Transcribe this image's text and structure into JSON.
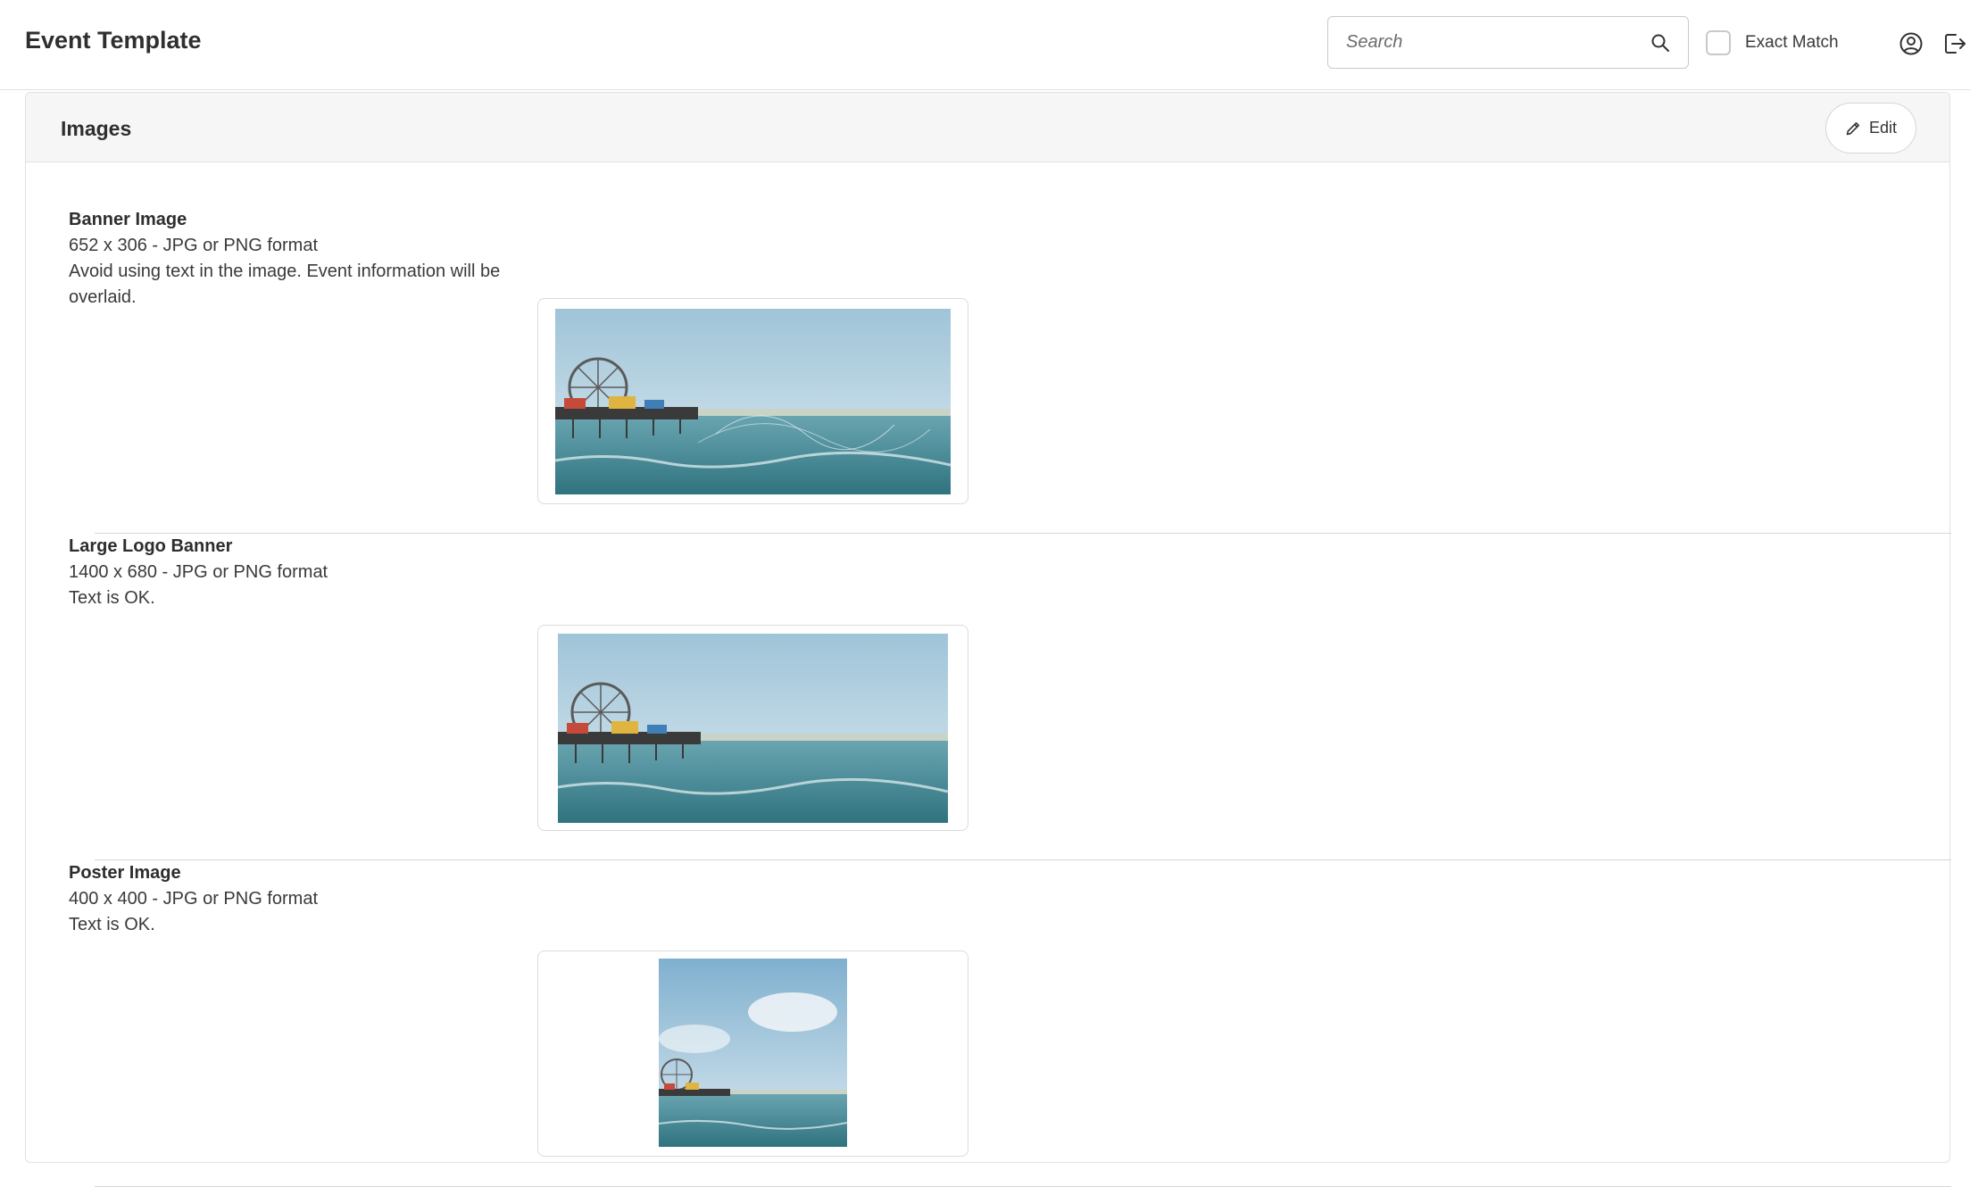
{
  "header": {
    "title": "Event Template",
    "search_placeholder": "Search",
    "search_value": "",
    "exact_match_label": "Exact Match",
    "exact_match_checked": false,
    "icons": [
      "search-icon",
      "user-icon",
      "logout-icon"
    ]
  },
  "images_section": {
    "title": "Images",
    "edit_label": "Edit",
    "rows": [
      {
        "title": "Banner Image",
        "spec": "652 x 306 - JPG or PNG format",
        "note": "Avoid using text in the image. Event information will be overlaid.",
        "thumbnail": "pier-banner-photo"
      },
      {
        "title": "Large Logo Banner",
        "spec": "1400 x 680 - JPG or PNG format",
        "note": "Text is OK.",
        "thumbnail": "pier-logo-banner-photo"
      },
      {
        "title": "Poster Image",
        "spec": "400 x 400 - JPG or PNG format",
        "note": "Text is OK.",
        "thumbnail": "pier-poster-photo"
      }
    ]
  },
  "colors": {
    "border": "#e2e2e2",
    "header_bg": "#f6f6f6",
    "text": "#2b2b2b",
    "sky": "#b9d6e4",
    "sea": "#3f8590"
  }
}
